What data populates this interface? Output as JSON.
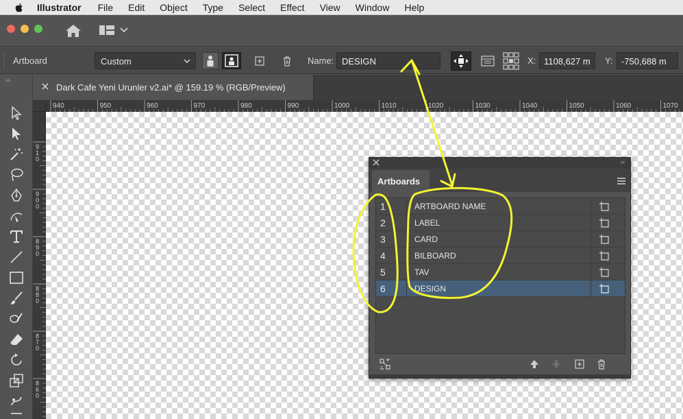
{
  "menubar": {
    "app_name": "Illustrator",
    "items": [
      "File",
      "Edit",
      "Object",
      "Type",
      "Select",
      "Effect",
      "View",
      "Window",
      "Help"
    ]
  },
  "controlbar": {
    "context_label": "Artboard",
    "preset_value": "Custom",
    "name_label": "Name:",
    "name_value": "DESIGN",
    "x_label": "X:",
    "x_value": "1108,627 m",
    "y_label": "Y:",
    "y_value": "-750,688 m"
  },
  "document": {
    "tab_title": "Dark Cafe Yeni Urunler v2.ai* @ 159.19 % (RGB/Preview)"
  },
  "rulers": {
    "top_ticks": [
      "940",
      "950",
      "960",
      "970",
      "980",
      "990",
      "1000",
      "1010",
      "1020",
      "1030",
      "1040",
      "1050",
      "1060",
      "1070"
    ],
    "left_ticks": [
      "910",
      "900",
      "890",
      "880",
      "870",
      "860"
    ]
  },
  "artboards_panel": {
    "tab_label": "Artboards",
    "rows": [
      {
        "num": "1",
        "name": "ARTBOARD NAME",
        "selected": false
      },
      {
        "num": "2",
        "name": "LABEL",
        "selected": false
      },
      {
        "num": "3",
        "name": "CARD",
        "selected": false
      },
      {
        "num": "4",
        "name": "BILBOARD",
        "selected": false
      },
      {
        "num": "5",
        "name": "TAV",
        "selected": false
      },
      {
        "num": "6",
        "name": "DESIGN",
        "selected": true
      }
    ]
  },
  "colors": {
    "selection": "#46607a",
    "annotation": "#f2f531",
    "panel_bg": "#535353"
  },
  "icons": [
    "apple-icon",
    "home-icon",
    "workspace-icon",
    "chevron-down-icon",
    "selection-tool-icon",
    "direct-selection-icon",
    "magic-wand-icon",
    "lasso-icon",
    "pen-icon",
    "curvature-icon",
    "type-icon",
    "line-icon",
    "rectangle-icon",
    "paintbrush-icon",
    "shaper-icon",
    "eraser-icon",
    "rotate-icon",
    "scale-icon",
    "warp-icon",
    "artboard-icon",
    "move-up-icon",
    "move-down-icon",
    "new-artboard-icon",
    "trash-icon",
    "rearrange-icon"
  ]
}
